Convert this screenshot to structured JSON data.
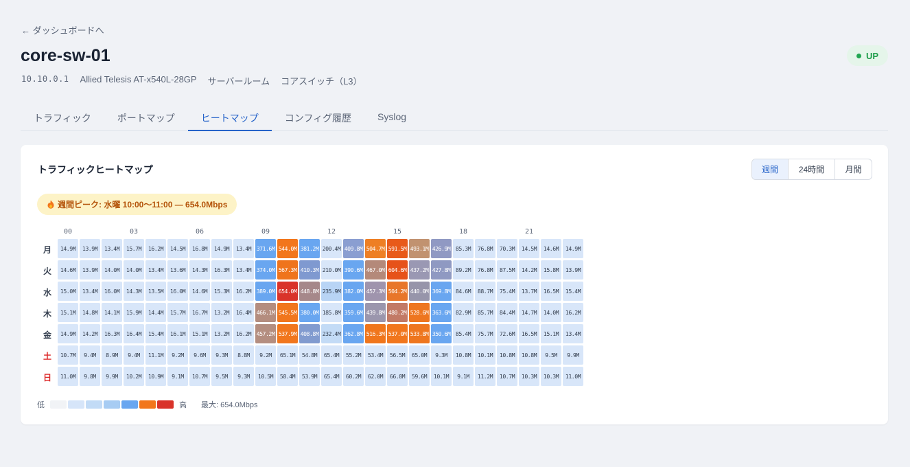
{
  "nav": {
    "back_label": "← ダッシュボードへ"
  },
  "device": {
    "name": "core-sw-01",
    "status": "UP",
    "ip": "10.10.0.1",
    "model": "Allied Telesis AT-x540L-28GP",
    "location": "サーバールーム",
    "role": "コアスイッチ（L3）"
  },
  "tabs": [
    {
      "label": "トラフィック",
      "active": false
    },
    {
      "label": "ポートマップ",
      "active": false
    },
    {
      "label": "ヒートマップ",
      "active": true
    },
    {
      "label": "コンフィグ履歴",
      "active": false
    },
    {
      "label": "Syslog",
      "active": false
    }
  ],
  "card": {
    "title": "トラフィックヒートマップ",
    "range_options": [
      {
        "label": "週間",
        "active": true
      },
      {
        "label": "24時間",
        "active": false
      },
      {
        "label": "月間",
        "active": false
      }
    ],
    "peak_icon": "fire-icon",
    "peak_text": "週間ピーク: 水曜 10:00〜11:00 — 654.0Mbps"
  },
  "chart_data": {
    "type": "heatmap",
    "hour_ticks": [
      "00",
      "03",
      "06",
      "09",
      "12",
      "15",
      "18",
      "21"
    ],
    "days": [
      {
        "label": "月",
        "weekend": false,
        "values": [
          "14.9M",
          "13.9M",
          "13.4M",
          "15.7M",
          "16.2M",
          "14.5M",
          "16.8M",
          "14.9M",
          "13.4M",
          "371.6M",
          "544.0M",
          "381.2M",
          "200.4M",
          "409.8M",
          "504.7M",
          "591.5M",
          "493.1M",
          "426.9M",
          "85.3M",
          "76.8M",
          "70.3M",
          "14.5M",
          "14.6M",
          "14.9M"
        ]
      },
      {
        "label": "火",
        "weekend": false,
        "values": [
          "14.6M",
          "13.9M",
          "14.0M",
          "14.0M",
          "13.4M",
          "13.6M",
          "14.3M",
          "16.3M",
          "13.4M",
          "374.0M",
          "567.3M",
          "410.3M",
          "210.0M",
          "390.6M",
          "467.0M",
          "604.6M",
          "437.2M",
          "427.8M",
          "89.2M",
          "76.8M",
          "87.5M",
          "14.2M",
          "15.8M",
          "13.9M"
        ]
      },
      {
        "label": "水",
        "weekend": false,
        "values": [
          "15.0M",
          "13.4M",
          "16.0M",
          "14.3M",
          "13.5M",
          "16.0M",
          "14.6M",
          "15.3M",
          "16.2M",
          "389.0M",
          "654.0M",
          "448.8M",
          "235.9M",
          "382.0M",
          "457.3M",
          "504.2M",
          "440.0M",
          "369.8M",
          "84.6M",
          "88.7M",
          "75.4M",
          "13.7M",
          "16.5M",
          "15.4M"
        ]
      },
      {
        "label": "木",
        "weekend": false,
        "values": [
          "15.1M",
          "14.8M",
          "14.1M",
          "15.9M",
          "14.4M",
          "15.7M",
          "16.7M",
          "13.2M",
          "16.4M",
          "466.1M",
          "545.5M",
          "380.0M",
          "185.8M",
          "359.6M",
          "439.8M",
          "480.2M",
          "528.6M",
          "363.6M",
          "82.9M",
          "85.7M",
          "84.4M",
          "14.7M",
          "14.0M",
          "16.2M"
        ]
      },
      {
        "label": "金",
        "weekend": false,
        "values": [
          "14.9M",
          "14.2M",
          "16.3M",
          "16.4M",
          "15.4M",
          "16.1M",
          "15.1M",
          "13.2M",
          "16.2M",
          "457.2M",
          "537.9M",
          "408.8M",
          "232.4M",
          "362.8M",
          "516.3M",
          "537.0M",
          "533.8M",
          "350.6M",
          "85.4M",
          "75.7M",
          "72.6M",
          "16.5M",
          "15.1M",
          "13.4M"
        ]
      },
      {
        "label": "土",
        "weekend": true,
        "values": [
          "10.7M",
          "9.4M",
          "8.9M",
          "9.4M",
          "11.1M",
          "9.2M",
          "9.6M",
          "9.3M",
          "8.8M",
          "9.2M",
          "65.1M",
          "54.8M",
          "65.4M",
          "55.2M",
          "53.4M",
          "56.5M",
          "65.0M",
          "9.3M",
          "10.8M",
          "10.1M",
          "10.8M",
          "10.8M",
          "9.5M",
          "9.9M"
        ]
      },
      {
        "label": "日",
        "weekend": true,
        "values": [
          "11.0M",
          "9.8M",
          "9.9M",
          "10.2M",
          "10.9M",
          "9.1M",
          "10.7M",
          "9.5M",
          "9.3M",
          "10.5M",
          "58.4M",
          "53.9M",
          "65.4M",
          "60.2M",
          "62.0M",
          "66.8M",
          "59.6M",
          "10.1M",
          "9.1M",
          "11.2M",
          "10.7M",
          "10.3M",
          "10.3M",
          "11.0M"
        ]
      }
    ],
    "cell_colors": [
      [
        "#d8e6f9",
        "#d8e6f9",
        "#d8e6f9",
        "#d8e6f9",
        "#d8e6f9",
        "#d8e6f9",
        "#d8e6f9",
        "#d8e6f9",
        "#d8e6f9",
        "#69a6f0",
        "#f2761c",
        "#69a6f0",
        "#d8e6f9",
        "#8a9ed1",
        "#ee7f24",
        "#e85a1a",
        "#c19270",
        "#9099c3",
        "#d8e6f9",
        "#d8e6f9",
        "#d8e6f9",
        "#d8e6f9",
        "#d8e6f9",
        "#d8e6f9"
      ],
      [
        "#d8e6f9",
        "#d8e6f9",
        "#d8e6f9",
        "#d8e6f9",
        "#d8e6f9",
        "#d8e6f9",
        "#d8e6f9",
        "#d8e6f9",
        "#d8e6f9",
        "#69a6f0",
        "#ef741c",
        "#7f99d0",
        "#d8e6f9",
        "#69a6f0",
        "#b4897a",
        "#e6521a",
        "#9a98b3",
        "#8f99c2",
        "#d8e6f9",
        "#d8e6f9",
        "#d8e6f9",
        "#d8e6f9",
        "#d8e6f9",
        "#d8e6f9"
      ],
      [
        "#d8e6f9",
        "#d8e6f9",
        "#d8e6f9",
        "#d8e6f9",
        "#d8e6f9",
        "#d8e6f9",
        "#d8e6f9",
        "#d8e6f9",
        "#d8e6f9",
        "#69a6f0",
        "#d9332a",
        "#a6888a",
        "#b8d4f5",
        "#69a6f0",
        "#9f94ad",
        "#e8762a",
        "#9795aa",
        "#69a6f0",
        "#d8e6f9",
        "#d8e6f9",
        "#d8e6f9",
        "#d8e6f9",
        "#d8e6f9",
        "#d8e6f9"
      ],
      [
        "#d8e6f9",
        "#d8e6f9",
        "#d8e6f9",
        "#d8e6f9",
        "#d8e6f9",
        "#d8e6f9",
        "#d8e6f9",
        "#d8e6f9",
        "#d8e6f9",
        "#b48d7f",
        "#f1761d",
        "#69a6f0",
        "#d8e6f9",
        "#69a6f0",
        "#9b96ad",
        "#c27a66",
        "#ee761f",
        "#69a6f0",
        "#d8e6f9",
        "#d8e6f9",
        "#d8e6f9",
        "#d8e6f9",
        "#d8e6f9",
        "#d8e6f9"
      ],
      [
        "#d8e6f9",
        "#d8e6f9",
        "#d8e6f9",
        "#d8e6f9",
        "#d8e6f9",
        "#d8e6f9",
        "#d8e6f9",
        "#d8e6f9",
        "#d8e6f9",
        "#b48e80",
        "#f1761d",
        "#819bcf",
        "#c3dbf6",
        "#69a6f0",
        "#f0761c",
        "#f1761d",
        "#ee761f",
        "#69a6f0",
        "#d8e6f9",
        "#d8e6f9",
        "#d8e6f9",
        "#d8e6f9",
        "#d8e6f9",
        "#d8e6f9"
      ],
      [
        "#d8e6f9",
        "#d8e6f9",
        "#d8e6f9",
        "#d8e6f9",
        "#d8e6f9",
        "#d8e6f9",
        "#d8e6f9",
        "#d8e6f9",
        "#d8e6f9",
        "#d8e6f9",
        "#d8e6f9",
        "#d8e6f9",
        "#d8e6f9",
        "#d8e6f9",
        "#d8e6f9",
        "#d8e6f9",
        "#d8e6f9",
        "#d8e6f9",
        "#d8e6f9",
        "#d8e6f9",
        "#d8e6f9",
        "#d8e6f9",
        "#d8e6f9",
        "#d8e6f9"
      ],
      [
        "#d8e6f9",
        "#d8e6f9",
        "#d8e6f9",
        "#d8e6f9",
        "#d8e6f9",
        "#d8e6f9",
        "#d8e6f9",
        "#d8e6f9",
        "#d8e6f9",
        "#d8e6f9",
        "#d8e6f9",
        "#d8e6f9",
        "#d8e6f9",
        "#d8e6f9",
        "#d8e6f9",
        "#d8e6f9",
        "#d8e6f9",
        "#d8e6f9",
        "#d8e6f9",
        "#d8e6f9",
        "#d8e6f9",
        "#d8e6f9",
        "#d8e6f9",
        "#d8e6f9"
      ]
    ],
    "max_mbps": 654.0
  },
  "legend": {
    "low_label": "低",
    "high_label": "高",
    "max_label": "最大: 654.0Mbps",
    "swatches": [
      "#f1f3f6",
      "#d6e5f9",
      "#c2dbf6",
      "#a7ccf3",
      "#69a6f0",
      "#f2761c",
      "#d9332a"
    ]
  },
  "colors": {
    "accent": "#2563c9",
    "status_up": "#22a652",
    "peak_bg": "#fdf3c7",
    "peak_text": "#b45309",
    "weekend": "#dc2626"
  }
}
